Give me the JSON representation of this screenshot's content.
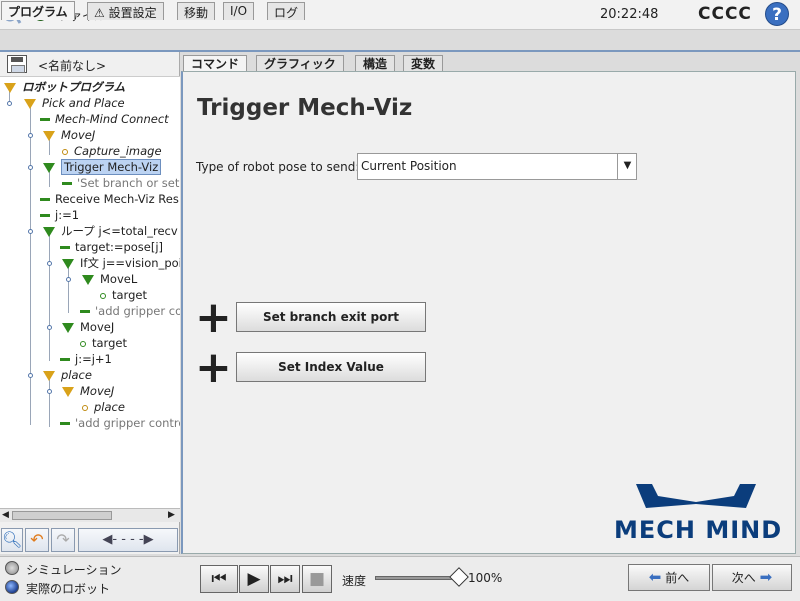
{
  "topbar": {
    "file_menu": "ファイル",
    "clock": "20:22:48",
    "robot_name": "CCCC",
    "help": "?"
  },
  "main_tabs": [
    "プログラム",
    "⚠ 設置設定",
    "移動",
    "I/O",
    "ログ"
  ],
  "program": {
    "name": "<名前なし>"
  },
  "tree": {
    "root": "ロボットプログラム",
    "nodes": [
      "Pick and Place",
      "Mech-Mind Connect",
      "MoveJ",
      "Capture_image",
      "Trigger Mech-Viz",
      "'Set branch or set i",
      "Receive Mech-Viz Res",
      "j:=1",
      "ループ j<=total_recv",
      "target:=pose[j]",
      "If文 j==vision_poi",
      "MoveL",
      "target",
      "'add gripper co",
      "MoveJ",
      "target",
      "j:=j+1",
      "place",
      "MoveJ",
      "place",
      "'add gripper contro"
    ]
  },
  "sub_tabs": [
    "コマンド",
    "グラフィック",
    "構造",
    "変数"
  ],
  "command": {
    "title": "Trigger Mech-Viz",
    "pose_label": "Type of robot pose to send:",
    "pose_value": "Current Position",
    "btn_branch": "Set branch exit port",
    "btn_index": "Set Index Value",
    "logo_text": "MECH MIND"
  },
  "bottom": {
    "sim_label": "シミュレーション",
    "real_label": "実際のロボット",
    "speed_label": "速度",
    "speed_value": "100%",
    "speed_level": 1.0,
    "prev": "前へ",
    "next": "次へ"
  },
  "colors": {
    "accent": "#7b98be",
    "logo": "#0b3d7c",
    "program_triangle": "#d9a21a",
    "active_node": "#2f8a1e"
  }
}
